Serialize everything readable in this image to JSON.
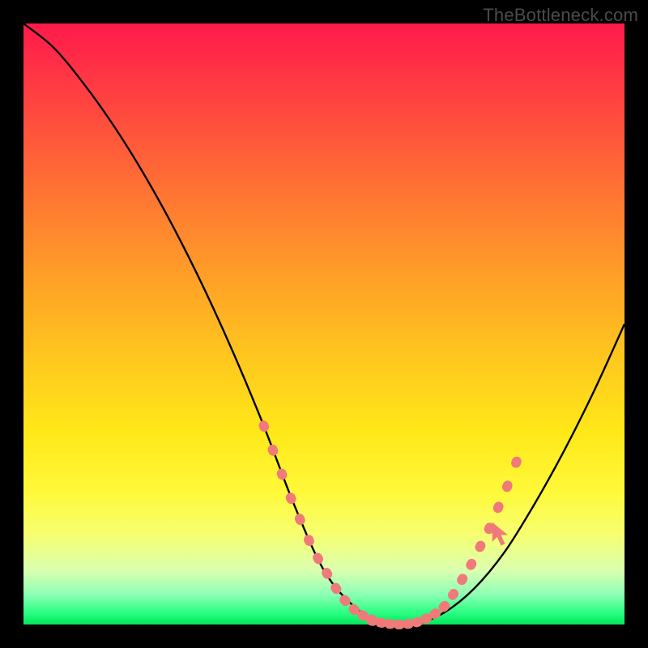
{
  "watermark": "TheBottleneck.com",
  "colors": {
    "frame": "#000000",
    "curve_stroke": "#000000",
    "highlight_fill": "#f07a7a",
    "highlight_stroke": "#e85a5a",
    "gradient_top": "#ff1a4b",
    "gradient_bottom": "#00e85a"
  },
  "chart_data": {
    "type": "line",
    "title": "",
    "xlabel": "",
    "ylabel": "",
    "xlim": [
      0,
      100
    ],
    "ylim": [
      0,
      100
    ],
    "grid": false,
    "series": [
      {
        "name": "bottleneck-curve",
        "x": [
          0,
          5,
          10,
          15,
          20,
          25,
          30,
          35,
          40,
          45,
          50,
          55,
          60,
          65,
          70,
          75,
          80,
          85,
          90,
          95,
          100
        ],
        "y": [
          100,
          96,
          90,
          83,
          75,
          66,
          56,
          45,
          33,
          20,
          9,
          3,
          0,
          0,
          2,
          6,
          12,
          20,
          29,
          39,
          50
        ]
      }
    ],
    "highlight_blobs_left": {
      "x": [
        40,
        41.5,
        43,
        44.5,
        46,
        47.5,
        49,
        50.5,
        52,
        53.5,
        55,
        56.5,
        58
      ],
      "y": [
        33,
        29,
        25,
        21,
        17.5,
        14,
        11,
        8.5,
        6,
        4,
        2.5,
        1.5,
        0.8
      ]
    },
    "highlight_blobs_bottom": {
      "x": [
        58,
        59.5,
        61,
        62.5,
        64,
        65.5,
        67,
        68.5,
        70
      ],
      "y": [
        0.6,
        0.3,
        0.1,
        0,
        0.1,
        0.4,
        1.0,
        1.8,
        3.0
      ]
    },
    "highlight_blobs_right": {
      "x": [
        70,
        71.5,
        73,
        74.5,
        76,
        77.5,
        79,
        80.5,
        82
      ],
      "y": [
        3.0,
        5,
        7.5,
        10,
        13,
        16,
        19.5,
        23,
        27
      ]
    },
    "cursor_arrow": {
      "x": 78,
      "y": 17
    }
  }
}
